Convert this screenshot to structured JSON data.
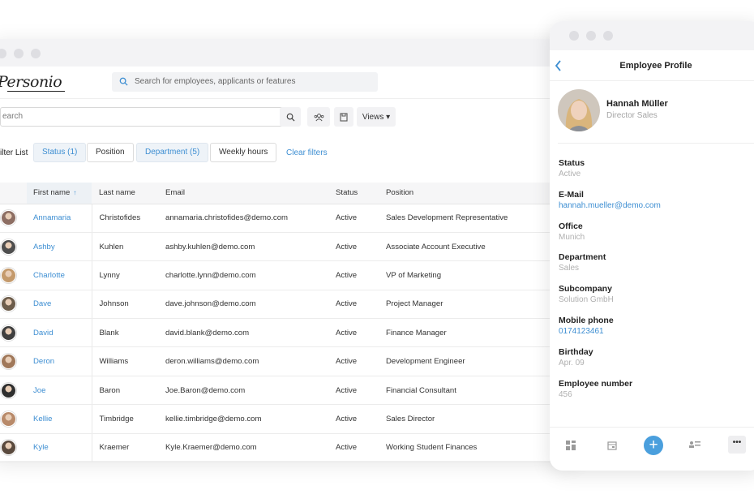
{
  "brand": {
    "name": "Personio"
  },
  "header": {
    "search_placeholder": "Search for employees, applicants or features"
  },
  "toolbar": {
    "search_placeholder": "earch",
    "views_label": "Views ▾"
  },
  "filters": {
    "label": "ilter List",
    "chips": [
      "Status (1)",
      "Position",
      "Department (5)",
      "Weekly hours"
    ],
    "clear_label": "Clear filters"
  },
  "table": {
    "columns": [
      "First name",
      "Last name",
      "Email",
      "Status",
      "Position"
    ],
    "rows": [
      {
        "first": "Annamaria",
        "last": "Christofides",
        "email": "annamaria.christofides@demo.com",
        "status": "Active",
        "position": "Sales Development Representative"
      },
      {
        "first": "Ashby",
        "last": "Kuhlen",
        "email": "ashby.kuhlen@demo.com",
        "status": "Active",
        "position": "Associate Account Executive"
      },
      {
        "first": "Charlotte",
        "last": "Lynny",
        "email": "charlotte.lynn@demo.com",
        "status": "Active",
        "position": "VP of Marketing"
      },
      {
        "first": "Dave",
        "last": "Johnson",
        "email": "dave.johnson@demo.com",
        "status": "Active",
        "position": "Project Manager"
      },
      {
        "first": "David",
        "last": "Blank",
        "email": "david.blank@demo.com",
        "status": "Active",
        "position": "Finance Manager"
      },
      {
        "first": "Deron",
        "last": "Williams",
        "email": "deron.williams@demo.com",
        "status": "Active",
        "position": "Development Engineer"
      },
      {
        "first": "Joe",
        "last": "Baron",
        "email": "Joe.Baron@demo.com",
        "status": "Active",
        "position": "Financial Consultant"
      },
      {
        "first": "Kellie",
        "last": "Timbridge",
        "email": "kellie.timbridge@demo.com",
        "status": "Active",
        "position": "Sales Director"
      },
      {
        "first": "Kyle",
        "last": "Kraemer",
        "email": "Kyle.Kraemer@demo.com",
        "status": "Active",
        "position": "Working Student Finances"
      }
    ]
  },
  "profile": {
    "header_title": "Employee Profile",
    "name": "Hannah Müller",
    "title": "Director Sales",
    "fields": [
      {
        "label": "Status",
        "value": "Active",
        "link": false
      },
      {
        "label": "E-Mail",
        "value": "hannah.mueller@demo.com",
        "link": true
      },
      {
        "label": "Office",
        "value": "Munich",
        "link": false
      },
      {
        "label": "Department",
        "value": "Sales",
        "link": false
      },
      {
        "label": "Subcompany",
        "value": "Solution GmbH",
        "link": false
      },
      {
        "label": "Mobile phone",
        "value": "0174123461",
        "link": true
      },
      {
        "label": "Birthday",
        "value": "Apr. 09",
        "link": false
      },
      {
        "label": "Employee number",
        "value": "456",
        "link": false
      }
    ],
    "more_label": "•••",
    "fab_label": "+"
  },
  "colors": {
    "accent": "#3d8ed2",
    "chip_active_bg": "#eef3f8",
    "fab": "#4a9fdd"
  }
}
